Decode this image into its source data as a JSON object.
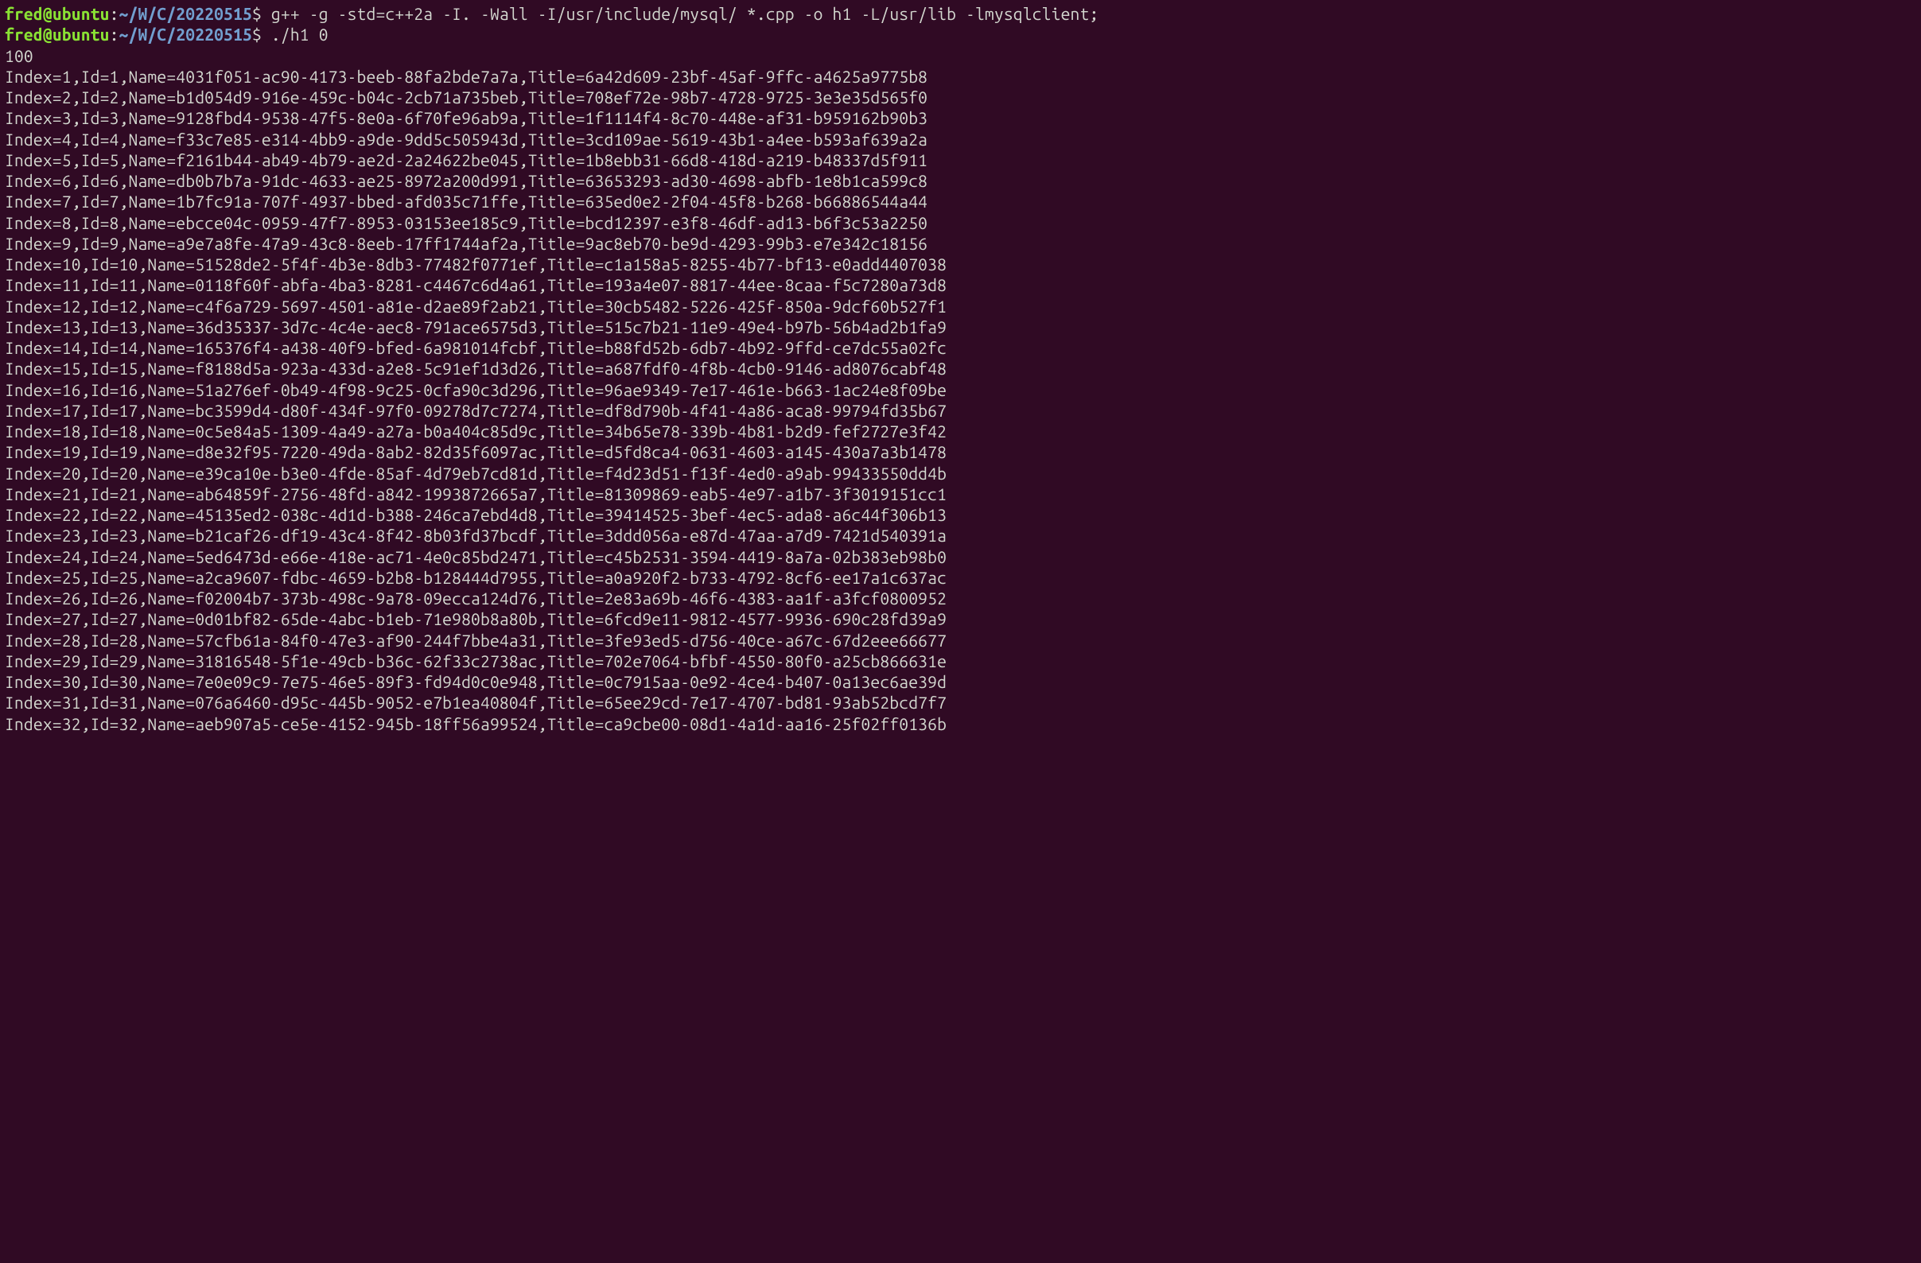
{
  "prompt": {
    "user": "fred",
    "at": "@",
    "host": "ubuntu",
    "colon": ":",
    "cwd": "~/W/C/20220515",
    "dollar": "$"
  },
  "commands": [
    {
      "text": "g++ -g -std=c++2a -I. -Wall -I/usr/include/mysql/ *.cpp -o h1 -L/usr/lib -lmysqlclient;",
      "wrap_at": 92
    },
    {
      "text": "./h1 0",
      "wrap_at": 0
    }
  ],
  "preamble_output": [
    "100"
  ],
  "rows": [
    {
      "Index": 1,
      "Id": 1,
      "Name": "4031f051-ac90-4173-beeb-88fa2bde7a7a",
      "Title": "6a42d609-23bf-45af-9ffc-a4625a9775b8"
    },
    {
      "Index": 2,
      "Id": 2,
      "Name": "b1d054d9-916e-459c-b04c-2cb71a735beb",
      "Title": "708ef72e-98b7-4728-9725-3e3e35d565f0"
    },
    {
      "Index": 3,
      "Id": 3,
      "Name": "9128fbd4-9538-47f5-8e0a-6f70fe96ab9a",
      "Title": "1f1114f4-8c70-448e-af31-b959162b90b3"
    },
    {
      "Index": 4,
      "Id": 4,
      "Name": "f33c7e85-e314-4bb9-a9de-9dd5c505943d",
      "Title": "3cd109ae-5619-43b1-a4ee-b593af639a2a"
    },
    {
      "Index": 5,
      "Id": 5,
      "Name": "f2161b44-ab49-4b79-ae2d-2a24622be045",
      "Title": "1b8ebb31-66d8-418d-a219-b48337d5f911"
    },
    {
      "Index": 6,
      "Id": 6,
      "Name": "db0b7b7a-91dc-4633-ae25-8972a200d991",
      "Title": "63653293-ad30-4698-abfb-1e8b1ca599c8"
    },
    {
      "Index": 7,
      "Id": 7,
      "Name": "1b7fc91a-707f-4937-bbed-afd035c71ffe",
      "Title": "635ed0e2-2f04-45f8-b268-b66886544a44"
    },
    {
      "Index": 8,
      "Id": 8,
      "Name": "ebcce04c-0959-47f7-8953-03153ee185c9",
      "Title": "bcd12397-e3f8-46df-ad13-b6f3c53a2250"
    },
    {
      "Index": 9,
      "Id": 9,
      "Name": "a9e7a8fe-47a9-43c8-8eeb-17ff1744af2a",
      "Title": "9ac8eb70-be9d-4293-99b3-e7e342c18156"
    },
    {
      "Index": 10,
      "Id": 10,
      "Name": "51528de2-5f4f-4b3e-8db3-77482f0771ef",
      "Title": "c1a158a5-8255-4b77-bf13-e0add4407038"
    },
    {
      "Index": 11,
      "Id": 11,
      "Name": "0118f60f-abfa-4ba3-8281-c4467c6d4a61",
      "Title": "193a4e07-8817-44ee-8caa-f5c7280a73d8"
    },
    {
      "Index": 12,
      "Id": 12,
      "Name": "c4f6a729-5697-4501-a81e-d2ae89f2ab21",
      "Title": "30cb5482-5226-425f-850a-9dcf60b527f1"
    },
    {
      "Index": 13,
      "Id": 13,
      "Name": "36d35337-3d7c-4c4e-aec8-791ace6575d3",
      "Title": "515c7b21-11e9-49e4-b97b-56b4ad2b1fa9"
    },
    {
      "Index": 14,
      "Id": 14,
      "Name": "165376f4-a438-40f9-bfed-6a981014fcbf",
      "Title": "b88fd52b-6db7-4b92-9ffd-ce7dc55a02fc"
    },
    {
      "Index": 15,
      "Id": 15,
      "Name": "f8188d5a-923a-433d-a2e8-5c91ef1d3d26",
      "Title": "a687fdf0-4f8b-4cb0-9146-ad8076cabf48"
    },
    {
      "Index": 16,
      "Id": 16,
      "Name": "51a276ef-0b49-4f98-9c25-0cfa90c3d296",
      "Title": "96ae9349-7e17-461e-b663-1ac24e8f09be"
    },
    {
      "Index": 17,
      "Id": 17,
      "Name": "bc3599d4-d80f-434f-97f0-09278d7c7274",
      "Title": "df8d790b-4f41-4a86-aca8-99794fd35b67"
    },
    {
      "Index": 18,
      "Id": 18,
      "Name": "0c5e84a5-1309-4a49-a27a-b0a404c85d9c",
      "Title": "34b65e78-339b-4b81-b2d9-fef2727e3f42"
    },
    {
      "Index": 19,
      "Id": 19,
      "Name": "d8e32f95-7220-49da-8ab2-82d35f6097ac",
      "Title": "d5fd8ca4-0631-4603-a145-430a7a3b1478"
    },
    {
      "Index": 20,
      "Id": 20,
      "Name": "e39ca10e-b3e0-4fde-85af-4d79eb7cd81d",
      "Title": "f4d23d51-f13f-4ed0-a9ab-99433550dd4b"
    },
    {
      "Index": 21,
      "Id": 21,
      "Name": "ab64859f-2756-48fd-a842-1993872665a7",
      "Title": "81309869-eab5-4e97-a1b7-3f3019151cc1"
    },
    {
      "Index": 22,
      "Id": 22,
      "Name": "45135ed2-038c-4d1d-b388-246ca7ebd4d8",
      "Title": "39414525-3bef-4ec5-ada8-a6c44f306b13"
    },
    {
      "Index": 23,
      "Id": 23,
      "Name": "b21caf26-df19-43c4-8f42-8b03fd37bcdf",
      "Title": "3ddd056a-e87d-47aa-a7d9-7421d540391a"
    },
    {
      "Index": 24,
      "Id": 24,
      "Name": "5ed6473d-e66e-418e-ac71-4e0c85bd2471",
      "Title": "c45b2531-3594-4419-8a7a-02b383eb98b0"
    },
    {
      "Index": 25,
      "Id": 25,
      "Name": "a2ca9607-fdbc-4659-b2b8-b128444d7955",
      "Title": "a0a920f2-b733-4792-8cf6-ee17a1c637ac"
    },
    {
      "Index": 26,
      "Id": 26,
      "Name": "f02004b7-373b-498c-9a78-09ecca124d76",
      "Title": "2e83a69b-46f6-4383-aa1f-a3fcf0800952"
    },
    {
      "Index": 27,
      "Id": 27,
      "Name": "0d01bf82-65de-4abc-b1eb-71e980b8a80b",
      "Title": "6fcd9e11-9812-4577-9936-690c28fd39a9"
    },
    {
      "Index": 28,
      "Id": 28,
      "Name": "57cfb61a-84f0-47e3-af90-244f7bbe4a31",
      "Title": "3fe93ed5-d756-40ce-a67c-67d2eee66677"
    },
    {
      "Index": 29,
      "Id": 29,
      "Name": "31816548-5f1e-49cb-b36c-62f33c2738ac",
      "Title": "702e7064-bfbf-4550-80f0-a25cb866631e"
    },
    {
      "Index": 30,
      "Id": 30,
      "Name": "7e0e09c9-7e75-46e5-89f3-fd94d0c0e948",
      "Title": "0c7915aa-0e92-4ce4-b407-0a13ec6ae39d"
    },
    {
      "Index": 31,
      "Id": 31,
      "Name": "076a6460-d95c-445b-9052-e7b1ea40804f",
      "Title": "65ee29cd-7e17-4707-bd81-93ab52bcd7f7"
    },
    {
      "Index": 32,
      "Id": 32,
      "Name": "aeb907a5-ce5e-4152-945b-18ff56a99524",
      "Title": "ca9cbe00-08d1-4a1d-aa16-25f02ff0136b"
    }
  ]
}
